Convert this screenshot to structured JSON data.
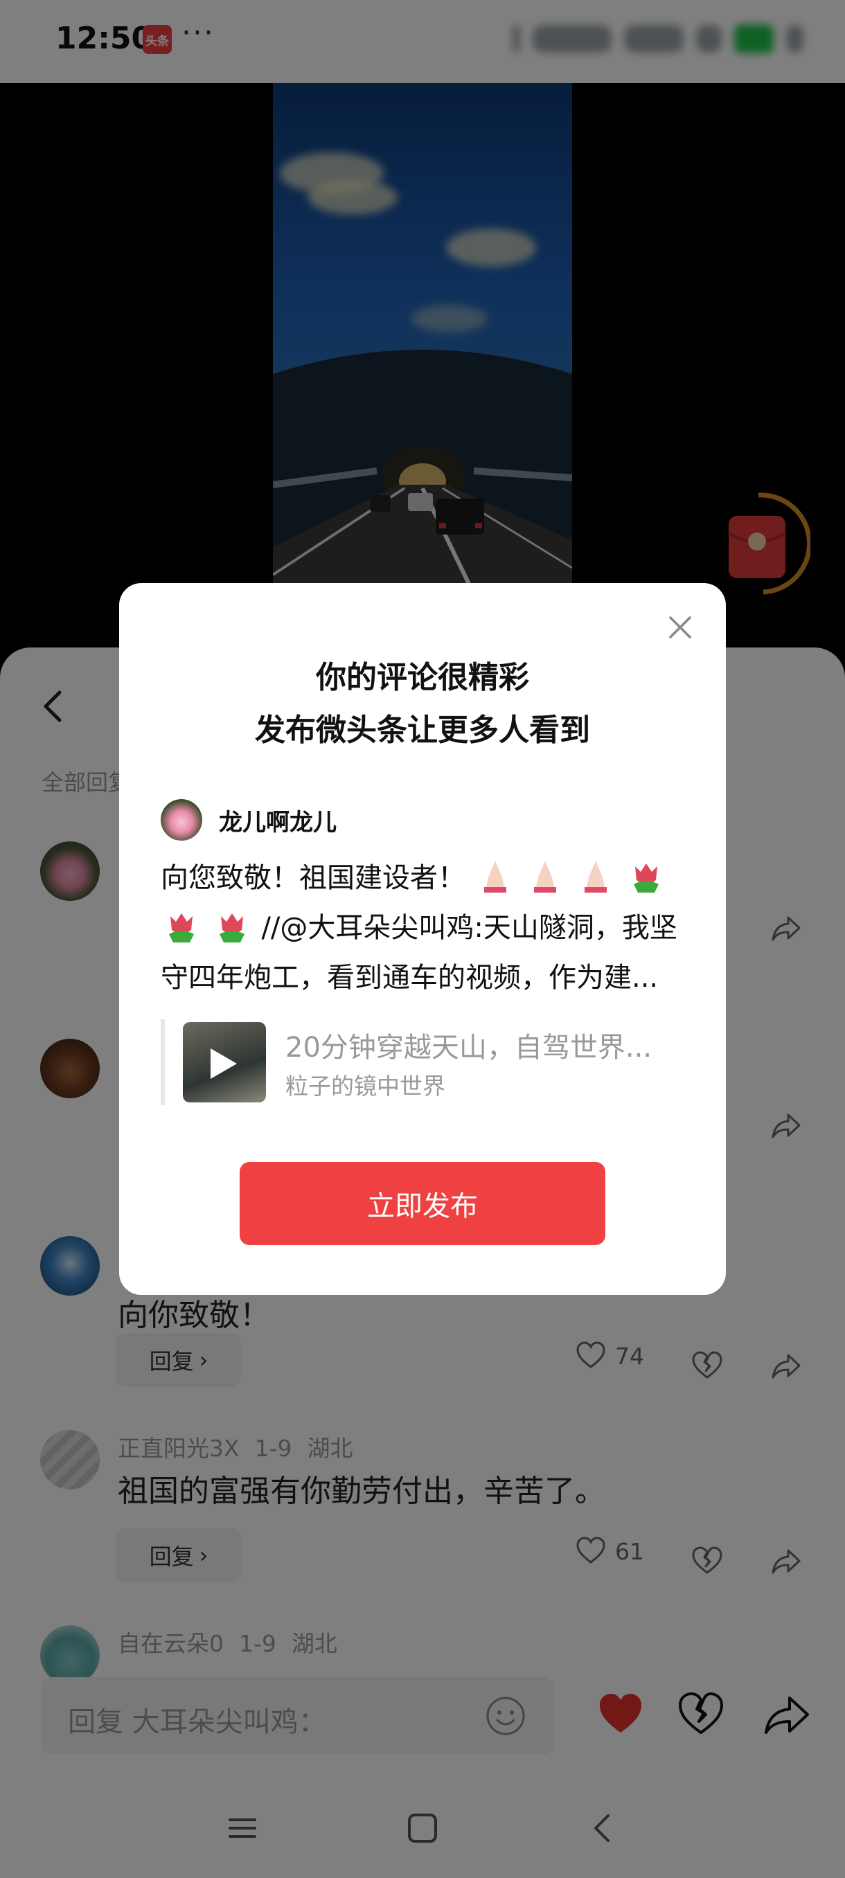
{
  "status_bar": {
    "time": "12:50",
    "app_badge": "头条",
    "more": "···"
  },
  "comments_sheet": {
    "tab_label": "全部回复",
    "comments": [
      {
        "author": "",
        "date": "",
        "location": "",
        "text": "",
        "likes": ""
      },
      {
        "author": "",
        "date": "",
        "location": "",
        "text": "",
        "likes": ""
      },
      {
        "author": "",
        "date": "",
        "location": "",
        "text": "向你致敬！",
        "likes": "74"
      },
      {
        "author": "正直阳光3X",
        "date": "1-9",
        "location": "湖北",
        "text": "祖国的富强有你勤劳付出，辛苦了。",
        "likes": "61"
      },
      {
        "author": "自在云朵0",
        "date": "1-9",
        "location": "湖北",
        "text": "",
        "likes": ""
      }
    ],
    "reply_label": "回复",
    "reply_chevron": "›"
  },
  "input_bar": {
    "placeholder": "回复 大耳朵尖叫鸡："
  },
  "dialog": {
    "title_line1": "你的评论很精彩",
    "title_line2": "发布微头条让更多人看到",
    "author_name": "龙儿啊龙儿",
    "body_line1": "向您致敬！祖国建设者！",
    "body_line2_text": "//@大耳朵尖叫鸡:天山隧洞，我坚",
    "body_line3": "守四年炮工，看到通车的视频，作为建...",
    "quote_title": "20分钟穿越天山，自驾世界...",
    "quote_source": "粒子的镜中世界",
    "publish_button": "立即发布"
  },
  "colors": {
    "accent": "#f04142",
    "heart": "#e5332c",
    "dim": "rgba(0,0,0,0.5)"
  },
  "icons": [
    "back-icon",
    "close-icon",
    "heart-icon",
    "heartbreak-icon",
    "share-icon",
    "emoji-icon",
    "menu-icon",
    "home-icon",
    "nav-back-icon",
    "play-icon",
    "red-packet-icon"
  ]
}
